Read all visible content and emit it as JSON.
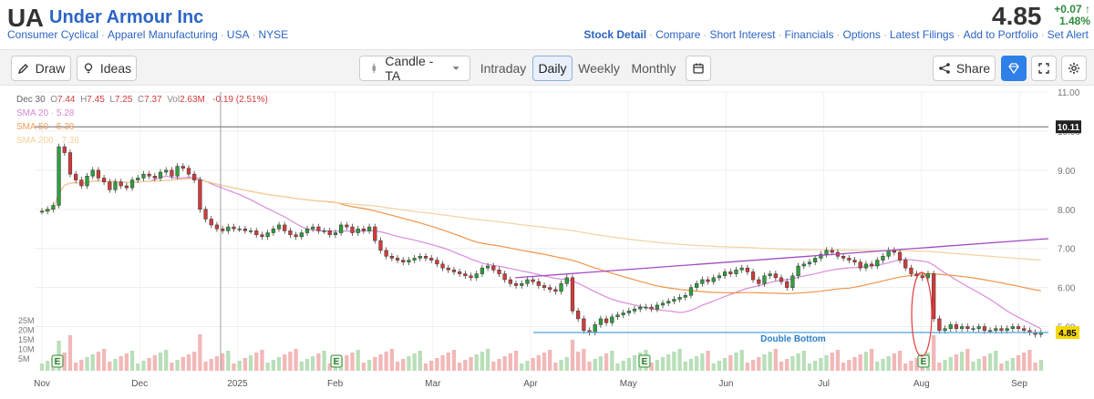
{
  "header": {
    "ticker": "UA",
    "company": "Under Armour Inc",
    "breadcrumbs": [
      "Consumer Cyclical",
      "Apparel Manufacturing",
      "USA",
      "NYSE"
    ],
    "price": "4.85",
    "change_abs": "+0.07",
    "change_pct": "1.48%",
    "nav": [
      "Stock Detail",
      "Compare",
      "Short Interest",
      "Financials",
      "Options",
      "Latest Filings",
      "Add to Portfolio",
      "Set Alert"
    ]
  },
  "toolbar": {
    "draw_label": "Draw",
    "ideas_label": "Ideas",
    "chart_type": "Candle - TA",
    "tabs": [
      "Intraday",
      "Daily",
      "Weekly",
      "Monthly"
    ],
    "active_tab": "Daily",
    "share_label": "Share"
  },
  "legend": {
    "date": "Dec 30",
    "o_label": "O",
    "o": "7.44",
    "h_label": "H",
    "h": "7.45",
    "l_label": "L",
    "l": "7.25",
    "c_label": "C",
    "c": "7.37",
    "vol_label": "Vol",
    "vol": "2.63M",
    "change": "-0.19 (2.51%)",
    "sma20": "SMA 20 · 5.28",
    "sma50": "SMA 50 · 5.39",
    "sma200": "SMA 200 · 7.36"
  },
  "colors": {
    "up": "#2e9e3c",
    "down": "#d33b3b",
    "sma20": "#d98bd9",
    "sma50": "#f0944a",
    "sma200": "#f3d2a0",
    "trend": "#a24cc4",
    "support": "#4da3e0"
  },
  "chart_data": {
    "type": "candlestick",
    "y_ticks": [
      "11.00",
      "10.00",
      "9.00",
      "8.00",
      "7.00",
      "6.00",
      "5.00"
    ],
    "x_ticks": [
      "Nov",
      "Dec",
      "2025",
      "Feb",
      "Mar",
      "Apr",
      "May",
      "Jun",
      "Jul",
      "Aug",
      "Sep"
    ],
    "vol_ticks": [
      "25M",
      "20M",
      "15M",
      "10M",
      "5M"
    ],
    "ylim": [
      4.5,
      11.0
    ],
    "crosshair_value": "10.11",
    "last_price_label": "4.85",
    "annotation": "Double Bottom",
    "earnings_label": "E",
    "closes": [
      7.95,
      8.0,
      8.1,
      9.6,
      9.45,
      8.9,
      8.75,
      8.6,
      8.85,
      9.0,
      8.8,
      8.7,
      8.5,
      8.7,
      8.6,
      8.55,
      8.75,
      8.8,
      8.9,
      8.85,
      8.8,
      8.95,
      9.0,
      8.85,
      9.1,
      9.05,
      8.9,
      8.75,
      8.0,
      7.75,
      7.6,
      7.5,
      7.45,
      7.55,
      7.5,
      7.5,
      7.45,
      7.45,
      7.35,
      7.3,
      7.4,
      7.5,
      7.6,
      7.45,
      7.35,
      7.3,
      7.4,
      7.5,
      7.55,
      7.45,
      7.45,
      7.35,
      7.4,
      7.6,
      7.55,
      7.4,
      7.5,
      7.45,
      7.55,
      7.2,
      6.95,
      6.8,
      6.75,
      6.7,
      6.65,
      6.7,
      6.75,
      6.8,
      6.75,
      6.7,
      6.6,
      6.5,
      6.45,
      6.4,
      6.35,
      6.3,
      6.25,
      6.35,
      6.5,
      6.55,
      6.45,
      6.35,
      6.2,
      6.1,
      6.05,
      6.1,
      6.2,
      6.15,
      6.05,
      6.0,
      5.95,
      5.9,
      6.1,
      6.25,
      5.4,
      5.2,
      4.9,
      4.85,
      5.05,
      5.2,
      5.1,
      5.25,
      5.3,
      5.35,
      5.4,
      5.45,
      5.5,
      5.5,
      5.45,
      5.55,
      5.6,
      5.65,
      5.7,
      5.75,
      5.8,
      6.0,
      6.1,
      6.2,
      6.15,
      6.25,
      6.3,
      6.4,
      6.35,
      6.45,
      6.5,
      6.4,
      6.2,
      6.1,
      6.3,
      6.35,
      6.25,
      6.15,
      6.0,
      6.3,
      6.55,
      6.6,
      6.65,
      6.75,
      6.85,
      6.95,
      6.9,
      6.8,
      6.75,
      6.7,
      6.65,
      6.5,
      6.6,
      6.55,
      6.7,
      6.8,
      6.95,
      6.9,
      6.7,
      6.5,
      6.35,
      6.3,
      6.25,
      6.35,
      5.2,
      4.9,
      4.95,
      5.05,
      4.95,
      5.0,
      4.95,
      4.95,
      5.0,
      4.9,
      4.9,
      4.95,
      4.9,
      4.95,
      5.0,
      4.95,
      4.9,
      4.85,
      4.8,
      4.85
    ]
  }
}
